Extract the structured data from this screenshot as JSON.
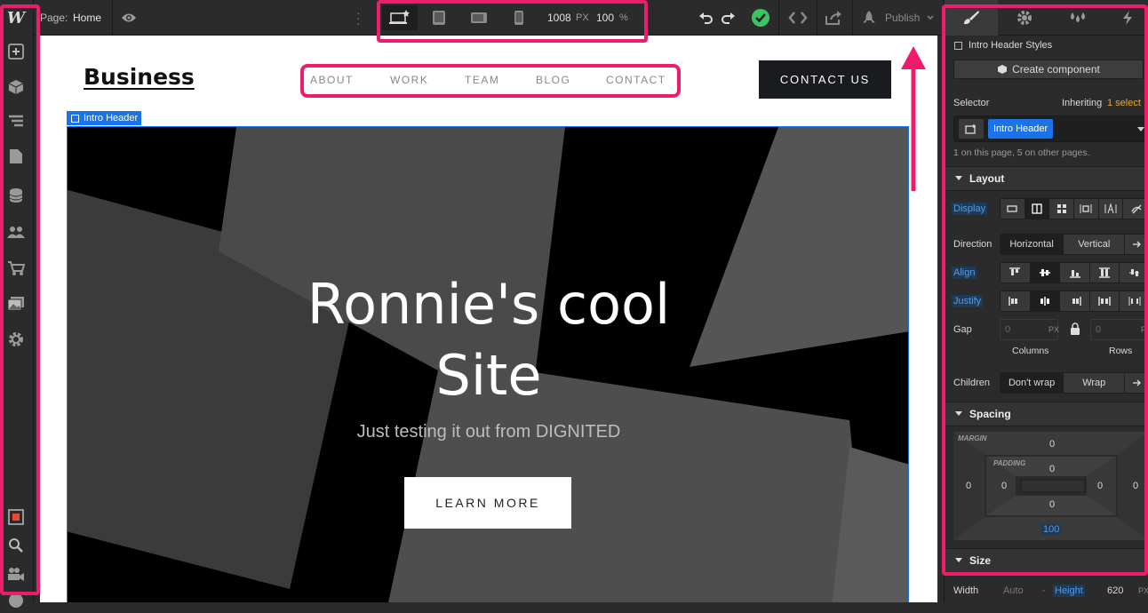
{
  "topbar": {
    "page_label": "Page:",
    "page_name": "Home",
    "width_value": "1008",
    "width_unit": "PX",
    "zoom_value": "100",
    "zoom_unit": "%",
    "publish_label": "Publish"
  },
  "site": {
    "logo": "Business",
    "nav": [
      "ABOUT",
      "WORK",
      "TEAM",
      "BLOG",
      "CONTACT"
    ],
    "cta": "CONTACT US",
    "selected_tag": "Intro Header",
    "hero_title_line1": "Ronnie's cool",
    "hero_title_line2": "Site",
    "hero_subtitle": "Just testing it out from DIGNITED",
    "hero_button": "LEARN MORE"
  },
  "panel": {
    "styles_title": "Intro Header Styles",
    "create_component": "Create component",
    "selector_label": "Selector",
    "inheriting_label": "Inheriting",
    "inheriting_count": "1 select",
    "selector_chip": "Intro Header",
    "usage_note": "1 on this page, 5 on other pages.",
    "layout_title": "Layout",
    "display_label": "Display",
    "direction_label": "Direction",
    "direction_horizontal": "Horizontal",
    "direction_vertical": "Vertical",
    "align_label": "Align",
    "justify_label": "Justify",
    "gap_label": "Gap",
    "gap_columns_placeholder": "0",
    "gap_columns_unit": "PX",
    "gap_rows_placeholder": "0",
    "gap_rows_unit": "P",
    "columns_label": "Columns",
    "rows_label": "Rows",
    "children_label": "Children",
    "children_nowrap": "Don't wrap",
    "children_wrap": "Wrap",
    "spacing_title": "Spacing",
    "margin_label": "MARGIN",
    "padding_label": "PADDING",
    "margin_top": "0",
    "margin_left": "0",
    "margin_right": "0",
    "padding_top": "0",
    "padding_left": "0",
    "padding_right": "0",
    "padding_bottom": "0",
    "margin_bottom": "100",
    "size_title": "Size",
    "width_label": "Width",
    "width_value": "Auto",
    "width_dash": "-",
    "height_label": "Height",
    "height_value": "620",
    "height_unit": "PX"
  },
  "colors": {
    "accent_pink": "#ee1d6b",
    "selection_blue": "#1a73e8",
    "status_green": "#3ac462",
    "chrome_dark": "#2b2b2b"
  }
}
